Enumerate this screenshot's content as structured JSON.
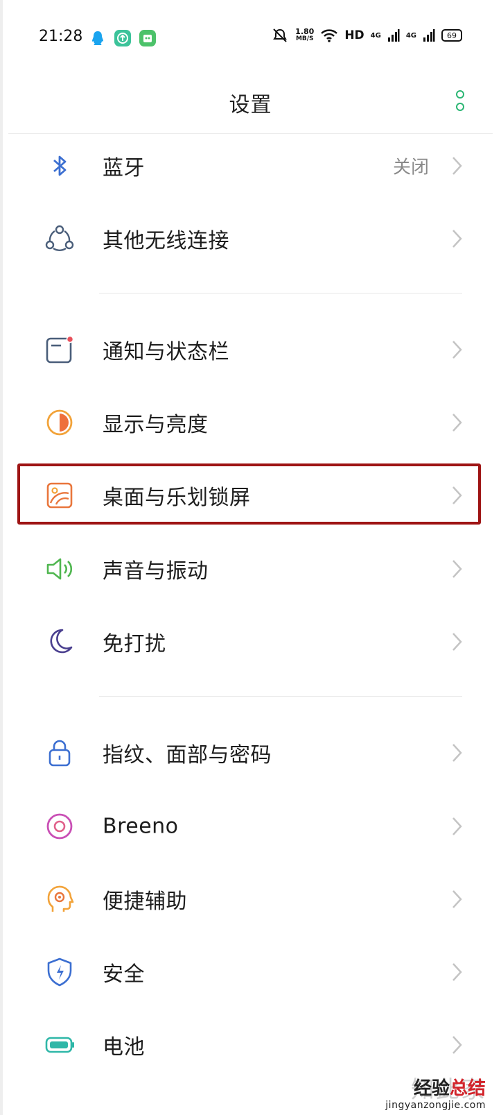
{
  "status_bar": {
    "time": "21:28",
    "speed_value": "1.80",
    "speed_unit": "MB/S",
    "hd": "HD",
    "net1": "4G",
    "net2": "4G",
    "battery": "69"
  },
  "header": {
    "title": "设置"
  },
  "items": [
    {
      "label": "蓝牙",
      "value": "关闭",
      "icon": "bluetooth-icon"
    },
    {
      "label": "其他无线连接",
      "icon": "wireless-connections-icon"
    },
    {
      "label": "通知与状态栏",
      "icon": "notification-icon"
    },
    {
      "label": "显示与亮度",
      "icon": "brightness-icon"
    },
    {
      "label": "桌面与乐划锁屏",
      "icon": "wallpaper-icon"
    },
    {
      "label": "声音与振动",
      "icon": "speaker-icon"
    },
    {
      "label": "免打扰",
      "icon": "moon-icon"
    },
    {
      "label": "指纹、面部与密码",
      "icon": "lock-icon"
    },
    {
      "label": "Breeno",
      "icon": "breeno-icon"
    },
    {
      "label": "便捷辅助",
      "icon": "assist-head-icon"
    },
    {
      "label": "安全",
      "icon": "shield-icon"
    },
    {
      "label": "电池",
      "icon": "battery-icon"
    }
  ],
  "colors": {
    "accent": "#2bb673",
    "highlight_border": "#9e1414"
  },
  "watermark": {
    "faded": "知此家",
    "main_a": "经验",
    "main_b": "总结",
    "url": "jingyanzongjie.com"
  }
}
